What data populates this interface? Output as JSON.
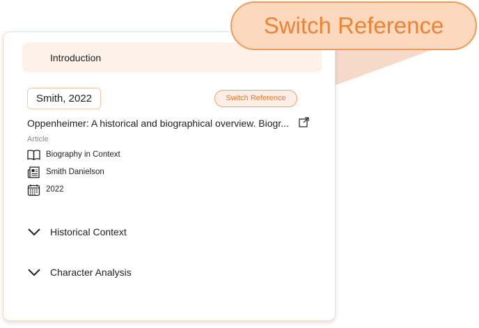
{
  "colors": {
    "accent": "#e8772e",
    "accent_light": "#fdeee3",
    "callout_bg": "#fcd9bd"
  },
  "nav": {
    "intro_label": "Introduction"
  },
  "reference": {
    "author_year": "Smith, 2022",
    "switch_label": "Switch Reference",
    "title": "Oppenheimer: A historical and biographical overview. Biogr...",
    "type": "Article",
    "meta": [
      {
        "icon": "book-icon",
        "text": "Biography in Context"
      },
      {
        "icon": "newspaper-icon",
        "text": "Smith Danielson"
      },
      {
        "icon": "calendar-icon",
        "text": "2022"
      }
    ]
  },
  "sections": [
    {
      "label": "Historical Context"
    },
    {
      "label": "Character Analysis"
    }
  ],
  "callout": {
    "label": "Switch Reference"
  }
}
